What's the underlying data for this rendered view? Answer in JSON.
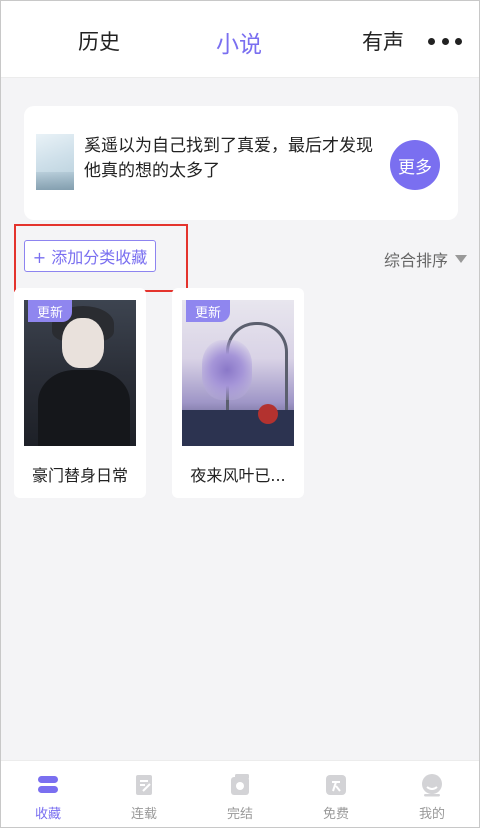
{
  "top_nav": {
    "tabs": [
      {
        "label": "历史",
        "active": false
      },
      {
        "label": "小说",
        "active": true
      },
      {
        "label": "有声",
        "active": false
      }
    ],
    "more_icon": "more-dots-icon"
  },
  "recommendation": {
    "text": "奚遥以为自己找到了真爱，最后才发现他真的想的太多了",
    "more_label": "更多"
  },
  "toolbar": {
    "add_category_label": "+ 添加分类收藏",
    "sort_label": "综合排序",
    "sort_icon": "triangle-down-icon"
  },
  "books": [
    {
      "title": "豪门替身日常",
      "badge": "更新"
    },
    {
      "title": "夜来风叶已...",
      "badge": "更新"
    }
  ],
  "bottom_tabs": [
    {
      "label": "收藏",
      "icon": "bookshelf-icon",
      "active": true
    },
    {
      "label": "连载",
      "icon": "serial-icon",
      "active": false
    },
    {
      "label": "完结",
      "icon": "completed-icon",
      "active": false
    },
    {
      "label": "免费",
      "icon": "free-icon",
      "active": false
    },
    {
      "label": "我的",
      "icon": "profile-icon",
      "active": false
    }
  ],
  "colors": {
    "accent": "#7a6ff0",
    "badge": "#8f86ef",
    "highlight": "#e4332d",
    "background": "#f4f4f6"
  }
}
